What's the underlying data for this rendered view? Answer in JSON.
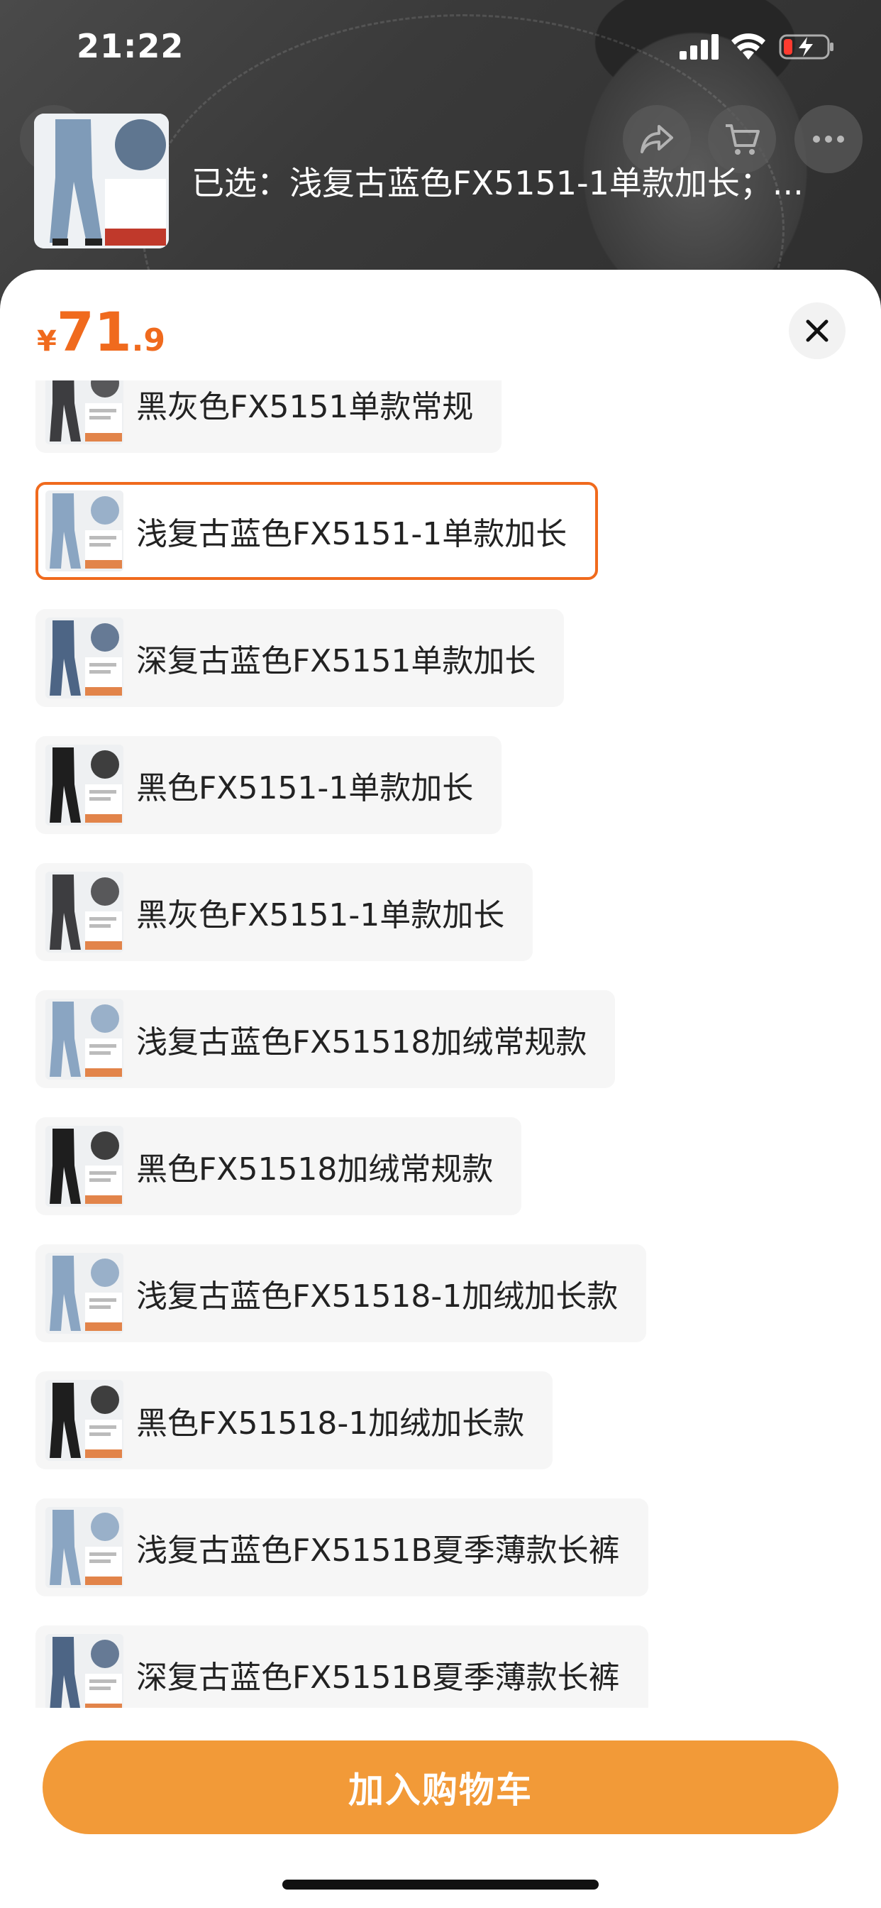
{
  "status_bar": {
    "time": "21:22",
    "signal_icon": "signal-icon",
    "wifi_icon": "wifi-icon",
    "battery_icon": "battery-charging-icon"
  },
  "header": {
    "selected_text": "已选：浅复古蓝色FX5151-1单款加长；...",
    "actions": [
      "share-icon",
      "cart-icon",
      "more-icon"
    ]
  },
  "sheet": {
    "price": {
      "currency": "¥",
      "integer": "71",
      "decimal": ".9",
      "color": "#f06a1d"
    },
    "close_icon": "close-icon",
    "variants": [
      {
        "label": "黑灰色FX5151单款常规",
        "selected": false,
        "tone": "dark-grey"
      },
      {
        "label": "浅复古蓝色FX5151-1单款加长",
        "selected": true,
        "tone": "light-blue"
      },
      {
        "label": "深复古蓝色FX5151单款加长",
        "selected": false,
        "tone": "dark-blue"
      },
      {
        "label": "黑色FX5151-1单款加长",
        "selected": false,
        "tone": "black"
      },
      {
        "label": "黑灰色FX5151-1单款加长",
        "selected": false,
        "tone": "dark-grey"
      },
      {
        "label": "浅复古蓝色FX51518加绒常规款",
        "selected": false,
        "tone": "light-blue"
      },
      {
        "label": "黑色FX51518加绒常规款",
        "selected": false,
        "tone": "black"
      },
      {
        "label": "浅复古蓝色FX51518-1加绒加长款",
        "selected": false,
        "tone": "light-blue"
      },
      {
        "label": "黑色FX51518-1加绒加长款",
        "selected": false,
        "tone": "black"
      },
      {
        "label": "浅复古蓝色FX5151B夏季薄款长裤",
        "selected": false,
        "tone": "light-blue"
      },
      {
        "label": "深复古蓝色FX5151B夏季薄款长裤",
        "selected": false,
        "tone": "dark-blue"
      }
    ],
    "cta_label": "加入购物车",
    "accent_color": "#f29a38"
  }
}
